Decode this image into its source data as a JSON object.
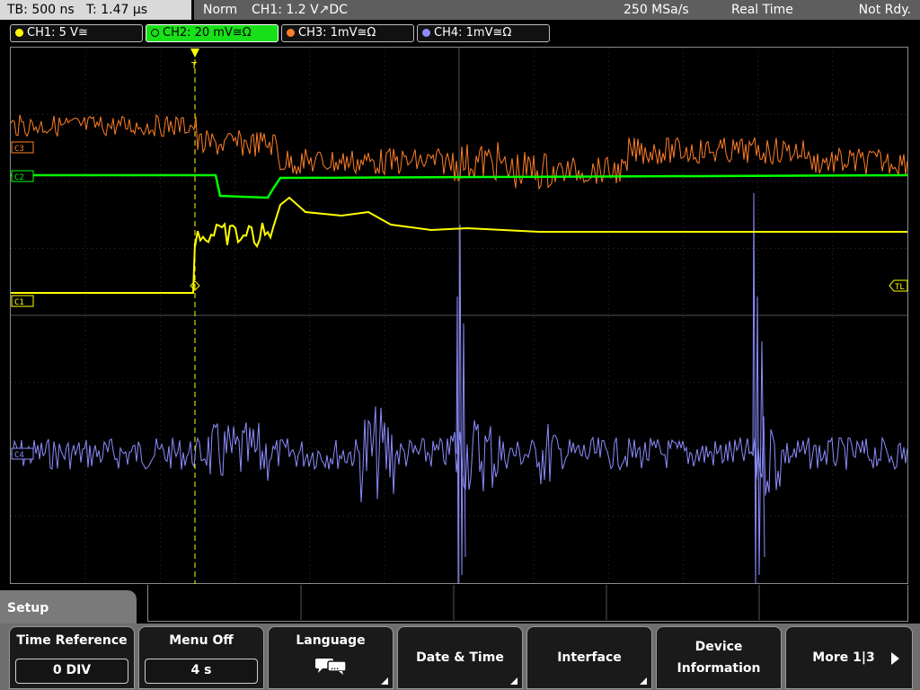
{
  "header": {
    "timebase": "TB: 500 ns",
    "trigger_time": "T: 1.47 µs",
    "trigger_mode": "Norm",
    "trigger_source": "CH1: 1.2 V",
    "trigger_slope_coupling": "↗DC",
    "sample_rate": "250 MSa/s",
    "acquisition_mode": "Real Time",
    "status": "Not Rdy."
  },
  "channels": [
    {
      "label": "CH1: 5 V",
      "coupling": "≅",
      "color": "#ffff00"
    },
    {
      "label": "CH2: 20 mV",
      "coupling": "≅Ω",
      "color": "#00ff00"
    },
    {
      "label": "CH3: 1mV",
      "coupling": "≅Ω",
      "color": "#ff7f27"
    },
    {
      "label": "CH4: 1mV",
      "coupling": "≅Ω",
      "color": "#8c8cff"
    }
  ],
  "markers": {
    "ch3": "C3",
    "ch2": "C2",
    "ch1": "C1",
    "ch4": "C4",
    "trigger_level": "TL",
    "trigger_position": "T"
  },
  "menu": {
    "title": "Setup",
    "softkeys": [
      {
        "label": "Time Reference",
        "value": "0 DIV"
      },
      {
        "label": "Menu Off",
        "value": "4 s"
      },
      {
        "label": "Language",
        "icon": "speech-bubbles-icon"
      },
      {
        "label": "Date & Time"
      },
      {
        "label": "Interface"
      },
      {
        "label": "Device",
        "label2": "Information"
      },
      {
        "label": "More 1|3"
      }
    ]
  },
  "colors": {
    "ch1": "#ffff00",
    "ch2": "#00ff00",
    "ch3": "#ff7f27",
    "ch4": "#8c8cff",
    "ch2_active_bg": "#18e018"
  }
}
